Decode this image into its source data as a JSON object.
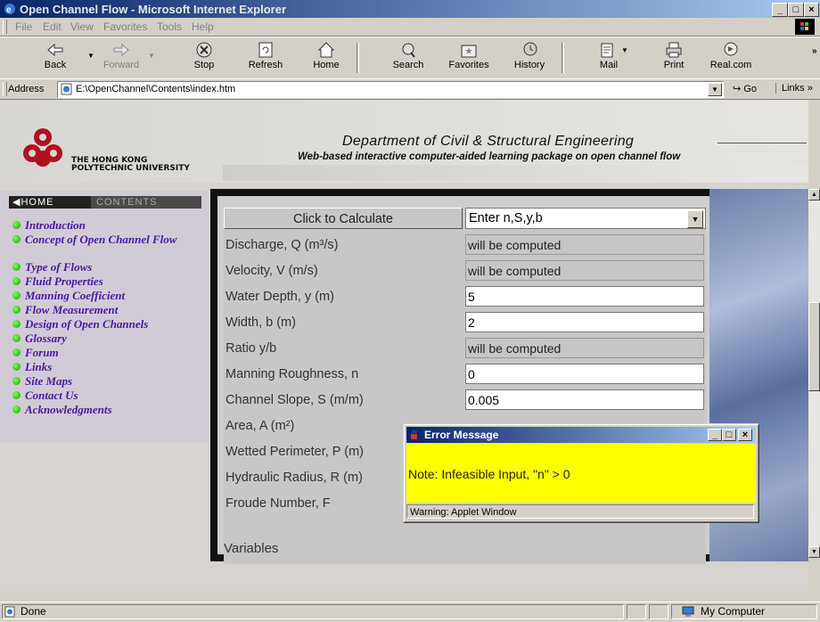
{
  "window": {
    "title": "Open Channel Flow - Microsoft Internet Explorer",
    "controls": [
      "_",
      "□",
      "×"
    ]
  },
  "menu": [
    "File",
    "Edit",
    "View",
    "Favorites",
    "Tools",
    "Help"
  ],
  "toolbar": [
    {
      "label": "Back",
      "icon": "back-arrow-icon",
      "enabled": true
    },
    {
      "label": "Forward",
      "icon": "forward-arrow-icon",
      "enabled": false
    },
    {
      "label": "Stop",
      "icon": "stop-icon",
      "enabled": true
    },
    {
      "label": "Refresh",
      "icon": "refresh-icon",
      "enabled": true
    },
    {
      "label": "Home",
      "icon": "home-icon",
      "enabled": true
    },
    {
      "label": "Search",
      "icon": "search-icon",
      "enabled": true
    },
    {
      "label": "Favorites",
      "icon": "favorites-icon",
      "enabled": true
    },
    {
      "label": "History",
      "icon": "history-icon",
      "enabled": true
    },
    {
      "label": "Mail",
      "icon": "mail-icon",
      "enabled": true
    },
    {
      "label": "Print",
      "icon": "print-icon",
      "enabled": true
    },
    {
      "label": "Real.com",
      "icon": "realcom-icon",
      "enabled": true
    }
  ],
  "address": {
    "label": "Address",
    "value": "E:\\OpenChannel\\Contents\\index.htm",
    "go_label": "Go",
    "links_label": "Links"
  },
  "header": {
    "university_line1": "THE HONG KONG",
    "university_line2": "POLYTECHNIC UNIVERSITY",
    "department": "Department of Civil & Structural Engineering",
    "subtitle": "Web-based interactive computer-aided learning package on open channel flow"
  },
  "sidebar": {
    "home_tab": "HOME",
    "contents_tab": "CONTENTS",
    "items": [
      "Introduction",
      "Concept of Open Channel Flow",
      "Type of Flows",
      "Fluid Properties",
      "Manning Coefficient",
      "Flow Measurement",
      "Design of Open Channels",
      "Glossary",
      "Forum",
      "Links",
      "Site Maps",
      "Contact Us",
      "Acknowledgments"
    ]
  },
  "applet": {
    "calc_button": "Click to Calculate",
    "mode_select": "Enter n,S,y,b",
    "rows": [
      {
        "label": "Discharge, Q (m³/s)",
        "value": "will be computed",
        "editable": false
      },
      {
        "label": "Velocity, V (m/s)",
        "value": "will be computed",
        "editable": false
      },
      {
        "label": "Water Depth, y (m)",
        "value": "5",
        "editable": true
      },
      {
        "label": "Width, b (m)",
        "value": "2",
        "editable": true
      },
      {
        "label": "Ratio y/b",
        "value": "will be computed",
        "editable": false
      },
      {
        "label": "Manning Roughness, n",
        "value": "0",
        "editable": true
      },
      {
        "label": "Channel Slope, S (m/m)",
        "value": "0.005",
        "editable": true
      },
      {
        "label": "Area, A (m²)",
        "value": "",
        "editable": false
      },
      {
        "label": "Wetted Perimeter, P (m)",
        "value": "",
        "editable": false
      },
      {
        "label": "Hydraulic Radius, R (m)",
        "value": "",
        "editable": false
      },
      {
        "label": "Froude Number, F",
        "value": "",
        "editable": false
      }
    ],
    "variables_label": "Variables"
  },
  "dialog": {
    "title": "Error Message",
    "message": "Note: Infeasible Input, \"n\" > 0",
    "status": "Warning: Applet Window"
  },
  "statusbar": {
    "left": "Done",
    "zone": "My Computer"
  }
}
